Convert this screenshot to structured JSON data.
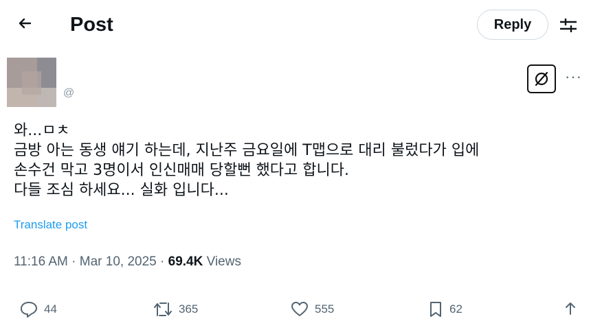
{
  "header": {
    "title": "Post",
    "reply_label": "Reply"
  },
  "author": {
    "handle": "@"
  },
  "post": {
    "lines": [
      "와...ㅁㅊ",
      "금방 아는 동생 얘기 하는데, 지난주 금요일에 T맵으로 대리 불렀다가 입에",
      "손수건 막고 3명이서 인신매매 당할뻔 했다고 합니다.",
      "다들 조심 하세요... 실화 입니다..."
    ],
    "translate_label": "Translate post",
    "time": "11:16 AM",
    "date": "Mar 10, 2025",
    "views_count": "69.4K",
    "views_label": "Views"
  },
  "actions": {
    "replies": "44",
    "reposts": "365",
    "likes": "555",
    "bookmarks": "62"
  },
  "icons": {
    "back": "arrow-left-icon",
    "filter": "sliders-icon",
    "grok": "grok-icon",
    "more": "more-icon",
    "reply": "comment-icon",
    "repost": "repost-icon",
    "like": "heart-icon",
    "bookmark": "bookmark-icon",
    "share": "share-icon"
  },
  "colors": {
    "link": "#1d9bf0",
    "muted": "#536471",
    "text": "#0f1419"
  }
}
